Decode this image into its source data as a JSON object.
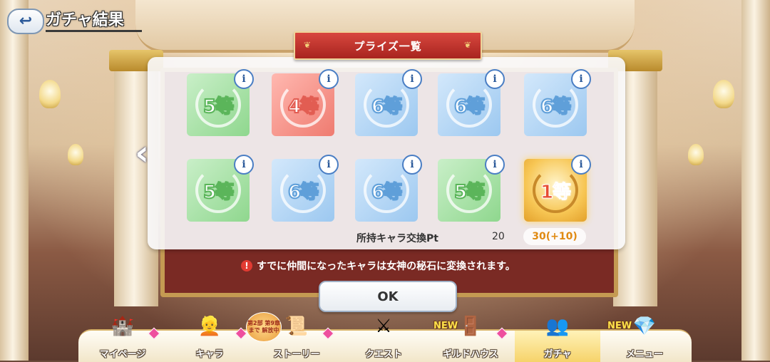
{
  "header": {
    "title": "ガチャ結果",
    "back_icon": "back-arrow-icon"
  },
  "prize_panel": {
    "title": "プライズ一覧",
    "info_label": "i",
    "tiles": [
      {
        "grade": "5等",
        "color": "green"
      },
      {
        "grade": "4等",
        "color": "red"
      },
      {
        "grade": "6等",
        "color": "blue"
      },
      {
        "grade": "6等",
        "color": "blue"
      },
      {
        "grade": "6等",
        "color": "blue"
      },
      {
        "grade": "5等",
        "color": "green"
      },
      {
        "grade": "6等",
        "color": "blue"
      },
      {
        "grade": "6等",
        "color": "blue"
      },
      {
        "grade": "5等",
        "color": "green"
      },
      {
        "grade": "1等",
        "color": "gold"
      }
    ],
    "points_label": "所持キャラ交換Pt",
    "points_current": "20",
    "points_new": "30(+10)"
  },
  "notice": "すでに仲間になったキャラは女神の秘石に変換されます。",
  "ok_label": "OK",
  "event_badge": "第2部 第9章まで 解放中",
  "nav": [
    {
      "label": "マイページ",
      "icon": "castle-icon",
      "new": "",
      "diamond": true,
      "active": false
    },
    {
      "label": "キャラ",
      "icon": "character-icon",
      "new": "",
      "diamond": true,
      "active": false
    },
    {
      "label": "ストーリー",
      "icon": "scroll-icon",
      "new": "",
      "diamond": true,
      "active": false
    },
    {
      "label": "クエスト",
      "icon": "sword-shield-icon",
      "new": "",
      "diamond": false,
      "active": false
    },
    {
      "label": "ギルドハウス",
      "icon": "door-icon",
      "new": "NEW",
      "diamond": true,
      "active": false
    },
    {
      "label": "ガチャ",
      "icon": "gacha-characters-icon",
      "new": "",
      "diamond": false,
      "active": true
    },
    {
      "label": "メニュー",
      "icon": "crystal-icon",
      "new": "NEW",
      "diamond": false,
      "active": false
    }
  ],
  "colors": {
    "ribbon": "#c23128",
    "gold_text": "#e08a12",
    "active_tab": "#f6d36a"
  }
}
